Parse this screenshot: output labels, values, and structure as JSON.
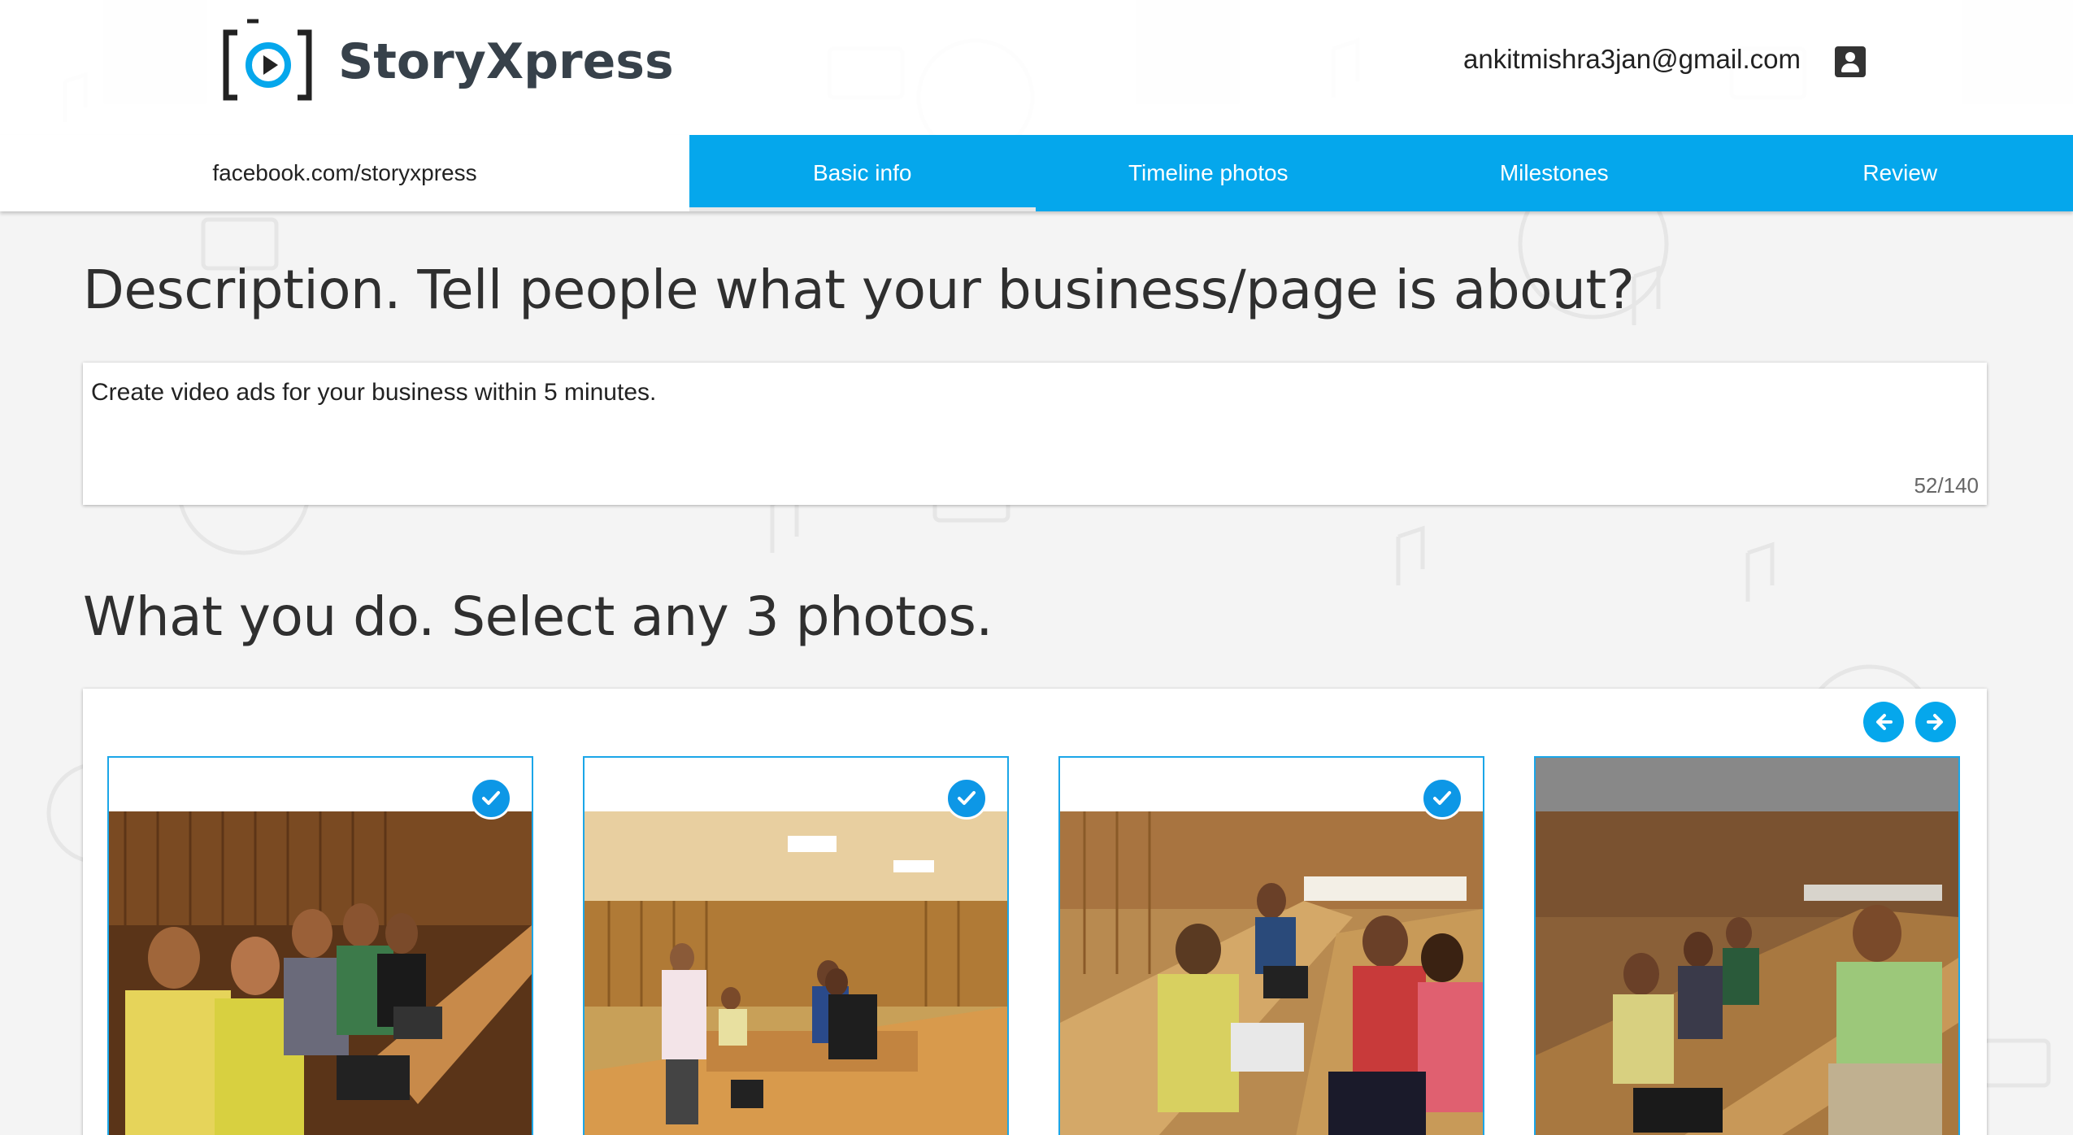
{
  "app": {
    "logo_text": "StoryXpress",
    "user_email": "ankitmishra3jan@gmail.com"
  },
  "tabbar": {
    "page_url": "facebook.com/storyxpress",
    "tabs": [
      {
        "label": "Basic info",
        "active": true
      },
      {
        "label": "Timeline photos",
        "active": false
      },
      {
        "label": "Milestones",
        "active": false
      },
      {
        "label": "Review",
        "active": false
      }
    ]
  },
  "description": {
    "title": "Description. Tell people what your business/page is about?",
    "value": "Create video ads for your business within 5 minutes.",
    "char_count": "52/140"
  },
  "photos": {
    "title": "What you do. Select any 3 photos.",
    "items": [
      {
        "selected": true
      },
      {
        "selected": true
      },
      {
        "selected": true
      },
      {
        "selected": false
      }
    ]
  },
  "colors": {
    "accent": "#05a7ec",
    "check": "#0d97e6",
    "logo_text": "#37414a"
  }
}
